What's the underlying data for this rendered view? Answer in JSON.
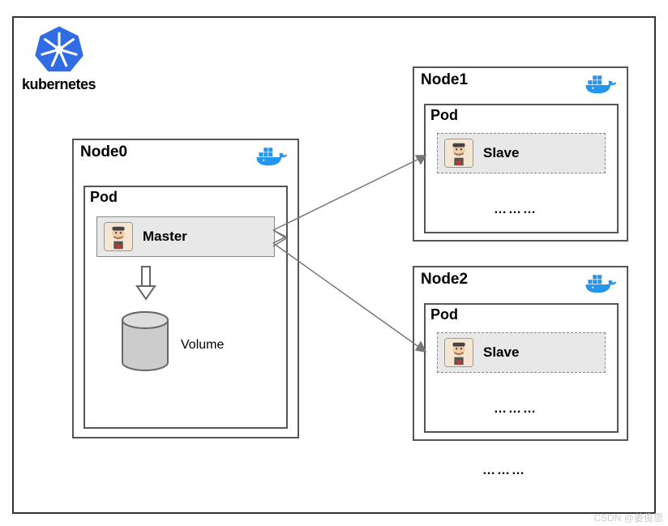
{
  "logo": {
    "name": "kubernetes"
  },
  "nodes": {
    "node0": {
      "title": "Node0",
      "pod_label": "Pod",
      "role_label": "Master",
      "volume_label": "Volume"
    },
    "node1": {
      "title": "Node1",
      "pod_label": "Pod",
      "role_label": "Slave",
      "dots": "………"
    },
    "node2": {
      "title": "Node2",
      "pod_label": "Pod",
      "role_label": "Slave",
      "dots": "………"
    },
    "global_dots": "………"
  },
  "watermark": "CSDN @姜俊恩"
}
